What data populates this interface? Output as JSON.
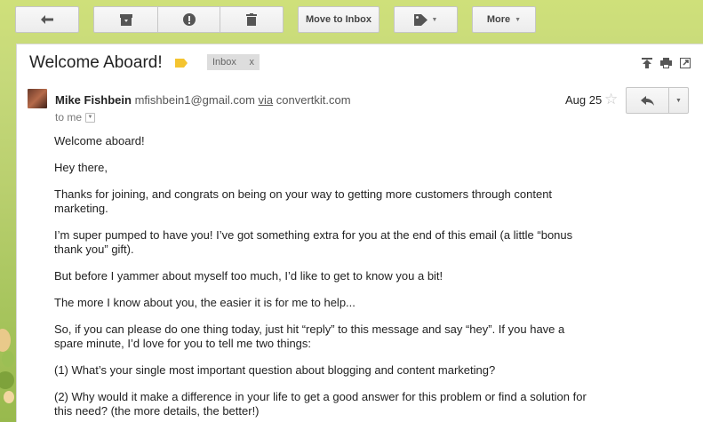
{
  "toolbar": {
    "back_icon": "arrow-left-icon",
    "archive_icon": "archive-icon",
    "spam_icon": "report-spam-icon",
    "delete_icon": "trash-icon",
    "move_to_inbox_label": "Move to Inbox",
    "labels_icon": "tag-icon",
    "more_label": "More"
  },
  "message": {
    "subject": "Welcome Aboard!",
    "label_chip": "Inbox",
    "label_chip_close": "x",
    "sender_name": "Mike Fishbein",
    "sender_email": "mfishbein1@gmail.com",
    "via_label": "via",
    "via_domain": "convertkit.com",
    "recipient": "to me",
    "date": "Aug 25",
    "paragraphs": [
      "Welcome aboard!",
      "Hey there,",
      "Thanks for joining, and congrats on being on your way to getting more customers through content marketing.",
      "I’m super pumped to have you! I’ve got something extra for you at the end of this email (a little “bonus thank you” gift).",
      "But before I yammer about myself too much, I’d like to get to know you a bit!",
      "The more I know about you, the easier it is for me to help...",
      "So, if you can please do one thing today, just hit “reply” to this message and say “hey”. If you have a spare minute, I’d love for you to tell me two things:",
      "(1) What’s your single most important question about blogging and content marketing?",
      "(2) Why would it make a difference in your life to get a good answer for this problem or find a solution for this need? (the more details, the better!)"
    ]
  },
  "colors": {
    "label_tag": "#f4c430",
    "background": "#b9cf6e"
  }
}
